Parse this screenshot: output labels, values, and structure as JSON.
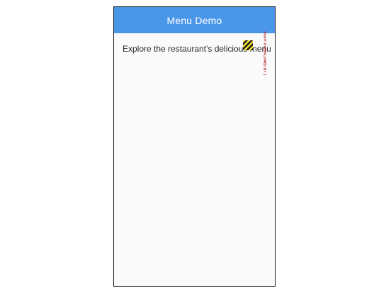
{
  "app_bar": {
    "title": "Menu Demo",
    "color": "#4a97ea"
  },
  "content": {
    "intro_text": "Explore the restaurant's delicious menu items below!"
  },
  "overflow_indicator": {
    "label": "RIGHT OVERFLOWED BY 1",
    "stripe_colors": [
      "#f6e230",
      "#1b1b1b"
    ],
    "label_color": "#b22222"
  }
}
